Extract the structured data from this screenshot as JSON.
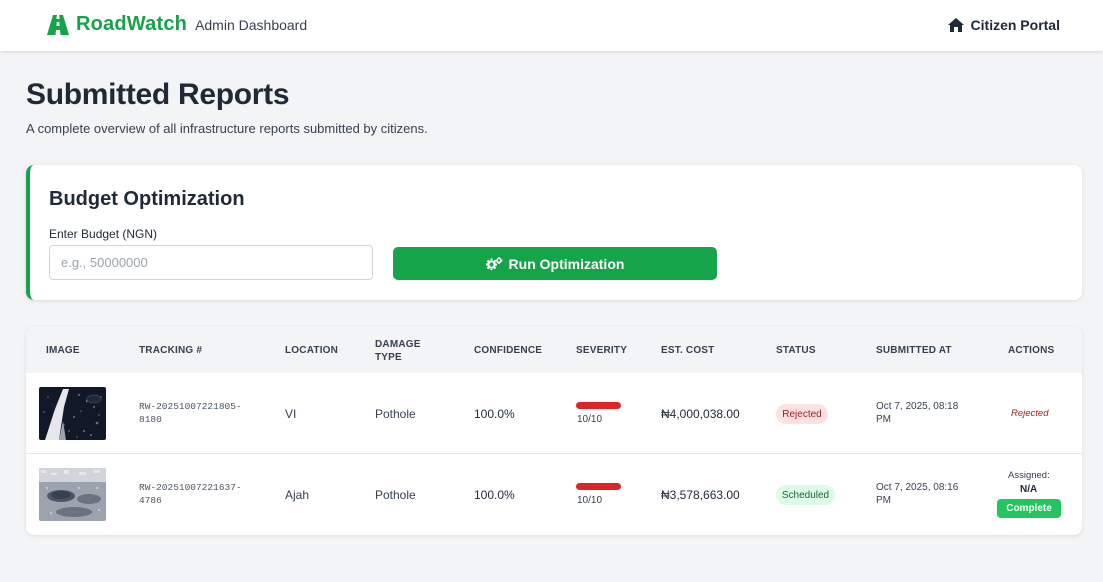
{
  "navbar": {
    "brand": "RoadWatch",
    "subtitle": "Admin Dashboard",
    "portal_link": "Citizen Portal",
    "brand_color": "#16a34a"
  },
  "page": {
    "title": "Submitted Reports",
    "subtitle": "A complete overview of all infrastructure reports submitted by citizens."
  },
  "budget": {
    "title": "Budget Optimization",
    "label": "Enter Budget (NGN)",
    "placeholder": "e.g., 50000000",
    "value": "",
    "button": "Run Optimization",
    "button_icon": "cogs-icon"
  },
  "table": {
    "headers": {
      "image": "Image",
      "tracking": "Tracking #",
      "location": "Location",
      "damage_type_1": "Damage",
      "damage_type_2": "Type",
      "confidence": "Confidence",
      "severity": "Severity",
      "est_cost": "Est. Cost",
      "status": "Status",
      "submitted_at": "Submitted At",
      "actions": "Actions"
    },
    "rows": [
      {
        "image": "pothole-thumbnail-1",
        "tracking_1": "RW-20251007221805-",
        "tracking_2": "8180",
        "location": "VI",
        "damage_type": "Pothole",
        "confidence": "100.0%",
        "severity_text": "10/10",
        "severity_fraction": 1.0,
        "est_cost": "₦4,000,038.00",
        "status": "Rejected",
        "submitted_1": "Oct 7, 2025, 08:18",
        "submitted_2": "PM",
        "action": "Rejected"
      },
      {
        "image": "pothole-thumbnail-2",
        "tracking_1": "RW-20251007221637-",
        "tracking_2": "4786",
        "location": "Ajah",
        "damage_type": "Pothole",
        "confidence": "100.0%",
        "severity_text": "10/10",
        "severity_fraction": 1.0,
        "est_cost": "₦3,578,663.00",
        "status": "Scheduled",
        "submitted_1": "Oct 7, 2025, 08:16",
        "submitted_2": "PM",
        "assigned_label": "Assigned:",
        "assigned_value": "N/A",
        "action_button": "Complete"
      }
    ]
  },
  "colors": {
    "primary_green": "#16a34a",
    "complete_green": "#22c55e",
    "severity_red": "#dc2626",
    "rejected_bg": "#fee2e2",
    "scheduled_bg": "#dcfce7"
  }
}
